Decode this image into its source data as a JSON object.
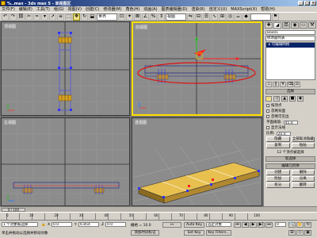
{
  "window": {
    "title": "%..max - 3ds max 5 - 单视图区",
    "buttons": [
      "_",
      "□",
      "×"
    ]
  },
  "menu": [
    "文件(F)",
    "编辑(E)",
    "工具(T)",
    "组(G)",
    "视图(V)",
    "创建(C)",
    "修改器(M)",
    "角色(H)",
    "动画(A)",
    "图表编辑器(D)",
    "渲染(R)",
    "自定义(U)",
    "MAXScript(X)",
    "帮助(H)"
  ],
  "toolbar": {
    "coord_dropdown": "世界",
    "selection_set": "视图",
    "icons": [
      "undo-icon",
      "redo-icon",
      "link-icon",
      "unlink-icon",
      "bind-icon",
      "select-icon",
      "select-by-name-icon",
      "region-icon",
      "move-icon",
      "rotate-icon",
      "scale-icon"
    ]
  },
  "viewports": {
    "top": "顶视图",
    "front": "前视图",
    "left": "左视图",
    "perspective": "透视图"
  },
  "command_panel": {
    "tabs": [
      "✚",
      "◢",
      "品",
      "◉",
      "▭",
      "⚒"
    ],
    "object_name": "Box01",
    "modifier_list": "修改器列表",
    "stack_item": "▸ 可编辑网格",
    "rollout_selection": "选择",
    "sel_tool_icons": [
      "vertex",
      "edge",
      "face",
      "polygon",
      "element"
    ],
    "chk_by_vertex": "按顶点",
    "chk_ignore_back": "忽略背面",
    "chk_ignore_visible": "忽略可见边",
    "planar_label": "平面阈值:",
    "planar_value": "45.0",
    "chk_show_normals": "显示法线",
    "scale_label": "比例:",
    "scale_value": "20.0",
    "btn_hide": "隐藏",
    "btn_unhide": "全部取消隐藏",
    "btn_copy": "复制",
    "btn_paste": "粘贴",
    "sel_status": "12 个顶点被选择",
    "rollout_soft": "软选择",
    "rollout_geometry": "编辑几何体",
    "btn_create": "创建",
    "btn_delete": "删除",
    "btn_attach": "附加",
    "btn_detach": "分离",
    "btn_divide": "拆分",
    "btn_turn": "翻转"
  },
  "timeline": {
    "slider": "0 / 100",
    "ticks": [
      "0",
      "10",
      "20",
      "30",
      "40",
      "50",
      "60",
      "70",
      "80",
      "90",
      "100"
    ]
  },
  "statusbar": {
    "selected": "1 个对象被选择",
    "x_value": "0.0",
    "y_value": "6.854",
    "z_value": "0.0",
    "grid": "栅格 = 10.0",
    "autokey": "Auto Key",
    "selected_dropdown": "选定对象",
    "setkey": "Set Key",
    "key_filters": "Key Filters...",
    "prompt": "单击并拖动以选择并移动对象",
    "add_time_tag": "添加时间标记",
    "frame": "0"
  }
}
